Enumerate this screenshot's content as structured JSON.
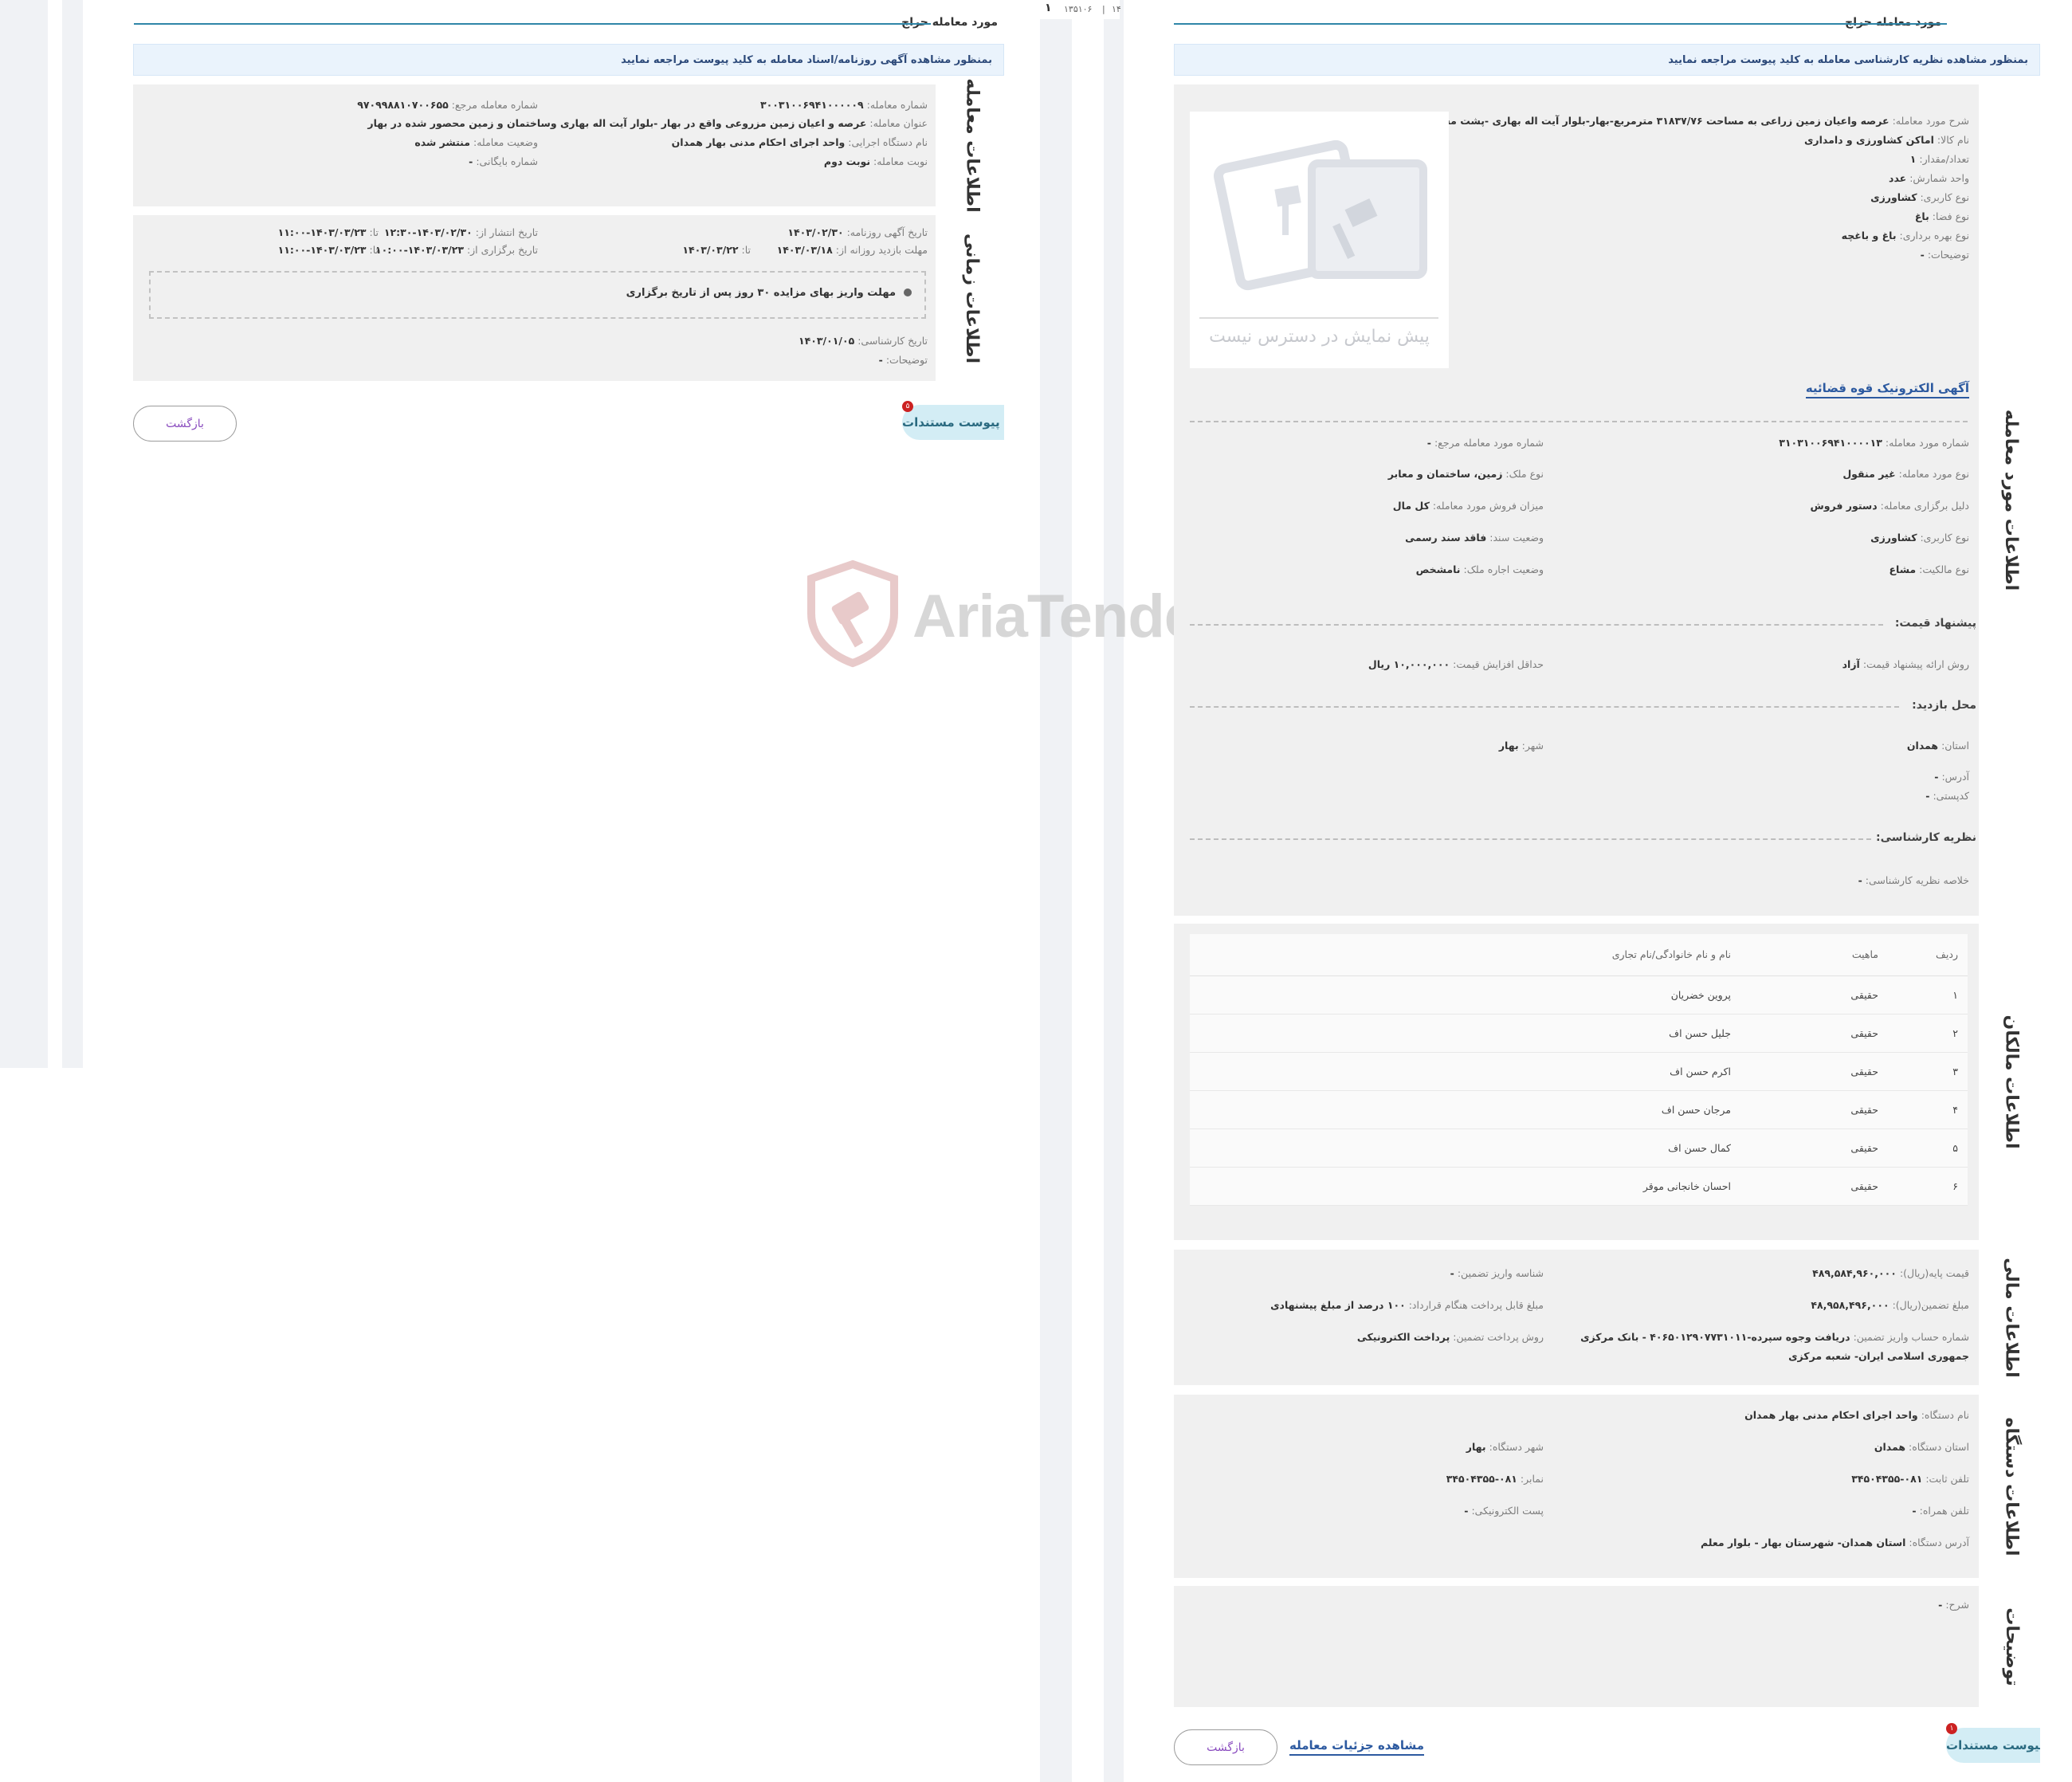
{
  "left_page": {
    "header_title": "مورد معامله حراج",
    "notice": "بمنظور مشاهده آگهی روزنامه/اسناد معامله به کلید پیوست مراجعه نمایید",
    "deal_info": {
      "tab_label": "اطلاعات معامله",
      "deal_number_label": "شماره معامله:",
      "deal_number": "۳۰۰۳۱۰۰۶۹۴۱۰۰۰۰۰۹",
      "ref_number_label": "شماره معامله مرجع:",
      "ref_number": "۹۷۰۹۹۸۸۱۰۷۰۰۶۵۵",
      "title_label": "عنوان معامله:",
      "title": "عرصه و اعیان زمین مزروعی واقع در بهار -بلوار آیت اله بهاری وساختمان و زمین محصور شده در بهار",
      "executor_label": "نام دستگاه اجرایی:",
      "executor": "واحد اجرای احکام مدنی بهار همدان",
      "status_label": "وضعیت معامله:",
      "status": "منتشر شده",
      "turn_label": "نوبت معامله:",
      "turn": "نوبت دوم",
      "archive_label": "شماره بایگانی:",
      "archive": "-"
    },
    "time_info": {
      "tab_label": "اطلاعات زمانی",
      "ad_date_label": "تاریخ آگهی روزنامه:",
      "ad_date": "۱۴۰۳/۰۲/۳۰",
      "publish_from_label": "تاریخ انتشار از:",
      "publish_from": "۱۴۰۳/۰۲/۳۰-۱۲:۳۰",
      "publish_to_label": "تا:",
      "publish_to": "۱۴۰۳/۰۳/۲۳-۱۱:۰۰",
      "visit_label": "مهلت بازدید روزانه از:",
      "visit_from": "۱۴۰۳/۰۳/۱۸",
      "visit_to_label": "تا:",
      "visit_to": "۱۴۰۳/۰۳/۲۲",
      "hold_from_label": "تاریخ برگزاری از:",
      "hold_from": "۱۴۰۳/۰۳/۲۳-۱۰:۰۰",
      "hold_to_label": "تا:",
      "hold_to": "۱۴۰۳/۰۳/۲۳-۱۱:۰۰",
      "deadline_note": "مهلت واریز بهای مزایده ۳۰ روز پس از تاریخ برگزاری",
      "expert_date_label": "تاریخ کارشناسی:",
      "expert_date": "۱۴۰۳/۰۱/۰۵",
      "desc_label": "توضیحات:",
      "desc": "-"
    },
    "attach_label": "پیوست مستندات",
    "attach_badge": "۵",
    "back_label": "بازگشت"
  },
  "mid_strip": {
    "mark": "۱",
    "text": "۱۳۵۱۰۶",
    "sep": "|",
    "num": "۱۴"
  },
  "watermark": {
    "text": "AriaTender.neT"
  },
  "right_page": {
    "header_title": "مورد معامله حراج",
    "notice": "بمنظور مشاهده نظریه کارشناسی معامله به کلید پیوست مراجعه نمایید",
    "item_info": {
      "tab_label": "اطلاعات مورد معامله",
      "desc_label": "شرح مورد معامله:",
      "desc": "عرصه واعیان زمین زراعی به مساحت ۳۱۸۳۷/۷۶ مترمربع-بهار-بلوار آیت اله بهاری -پشت مسکن مهر",
      "goods_label": "نام کالا:",
      "goods": "اماکن کشاورزی و دامداری",
      "qty_label": "تعداد/مقدار:",
      "qty": "۱",
      "unit_label": "واحد شمارش:",
      "unit": "عدد",
      "usage_label": "نوع کاربری:",
      "usage": "کشاورزی",
      "space_label": "نوع فضا:",
      "space": "باغ",
      "exploit_label": "نوع بهره برداری:",
      "exploit": "باغ و باغچه",
      "notes_label": "توضیحات:",
      "notes": "-",
      "preview_text": "پیش نمایش در دسترس نیست",
      "eaghi_link": "آگهی الکترونیک قوه قضائیه",
      "item_number_label": "شماره مورد معامله:",
      "item_number": "۳۱۰۳۱۰۰۶۹۴۱۰۰۰۰۱۳",
      "item_ref_label": "شماره مورد معامله مرجع:",
      "item_ref": "-",
      "item_type_label": "نوع مورد معامله:",
      "item_type": "غیر منقول",
      "property_type_label": "نوع ملک:",
      "property_type": "زمین، ساختمان و معابر",
      "reason_label": "دلیل برگزاری معامله:",
      "reason": "دستور فروش",
      "sale_amount_label": "میزان فروش مورد معامله:",
      "sale_amount": "کل مال",
      "usage2_label": "نوع کاربری:",
      "usage2": "کشاورزی",
      "doc_status_label": "وضعیت سند:",
      "doc_status": "فاقد سند رسمی",
      "ownership_label": "نوع مالکیت:",
      "ownership": "مشاع",
      "lease_label": "وضعیت اجاره ملک:",
      "lease": "نامشخص",
      "price_head": "پیشنهاد قیمت:",
      "price_method_label": "روش ارائه پیشنهاد قیمت:",
      "price_method": "آزاد",
      "min_increase_label": "حداقل افزایش قیمت:",
      "min_increase": "۱۰,۰۰۰,۰۰۰ ریال",
      "visit_head": "محل بازدید:",
      "province_label": "استان:",
      "province": "همدان",
      "city_label": "شهر:",
      "city": "بهار",
      "address_label": "آدرس:",
      "address": "-",
      "postal_label": "کدپستی:",
      "postal": "-",
      "expert_head": "نظریه کارشناسی:",
      "expert_summary_label": "خلاصه نظریه کارشناسی:",
      "expert_summary": "-"
    },
    "owners": {
      "tab_label": "اطلاعات مالکان",
      "columns": [
        "ردیف",
        "ماهیت",
        "نام و نام خانوادگی/نام تجاری"
      ],
      "rows": [
        [
          "۱",
          "حقیقی",
          "پروین خضریان"
        ],
        [
          "۲",
          "حقیقی",
          "جلیل حسن اف"
        ],
        [
          "۳",
          "حقیقی",
          "اکرم حسن اف"
        ],
        [
          "۴",
          "حقیقی",
          "مرجان حسن اف"
        ],
        [
          "۵",
          "حقیقی",
          "کمال حسن اف"
        ],
        [
          "۶",
          "حقیقی",
          "احسان خانجانی موقر"
        ]
      ]
    },
    "finance": {
      "tab_label": "اطلاعات مالی",
      "base_price_label": "قیمت پایه(ریال):",
      "base_price": "۴۸۹,۵۸۴,۹۶۰,۰۰۰",
      "deposit_id_label": "شناسه واریز تضمین:",
      "deposit_id": "-",
      "guarantee_label": "مبلغ تضمین(ریال):",
      "guarantee": "۴۸,۹۵۸,۴۹۶,۰۰۰",
      "payable_label": "مبلغ قابل پرداخت هنگام قرارداد:",
      "payable": "۱۰۰ درصد از مبلغ پیشنهادی",
      "account_label": "شماره حساب واریز تضمین:",
      "account": "دریافت وجوه سپرده-۴۰۶۵۰۱۲۹۰۷۷۳۱۰۱۱ - بانک مرکزی",
      "account_line2": "جمهوری اسلامی ایران- شعبه مرکزی",
      "pay_method_label": "روش پرداخت تضمین:",
      "pay_method": "پرداخت الکترونیکی"
    },
    "agency": {
      "tab_label": "اطلاعات دستگاه",
      "name_label": "نام دستگاه:",
      "name": "واحد اجرای احکام مدنی بهار همدان",
      "province_label": "استان دستگاه:",
      "province": "همدان",
      "city_label": "شهر دستگاه:",
      "city": "بهار",
      "phone_label": "تلفن ثابت:",
      "phone": "۰۸۱-۳۴۵۰۴۳۵۵",
      "fax_label": "نمابر:",
      "fax": "۰۸۱-۳۴۵۰۴۳۵۵",
      "mobile_label": "تلفن همراه:",
      "mobile": "-",
      "email_label": "پست الکترونیکی:",
      "email": "-",
      "address_label": "آدرس دستگاه:",
      "address": "استان همدان- شهرستان بهار - بلوار معلم"
    },
    "remarks": {
      "tab_label": "توضیحات",
      "sharh_label": "شرح:",
      "sharh": "-"
    },
    "attach_label": "پیوست مستندات",
    "attach_badge": "۱",
    "details_link": "مشاهده جزئیات معامله",
    "back_label": "بازگشت"
  }
}
